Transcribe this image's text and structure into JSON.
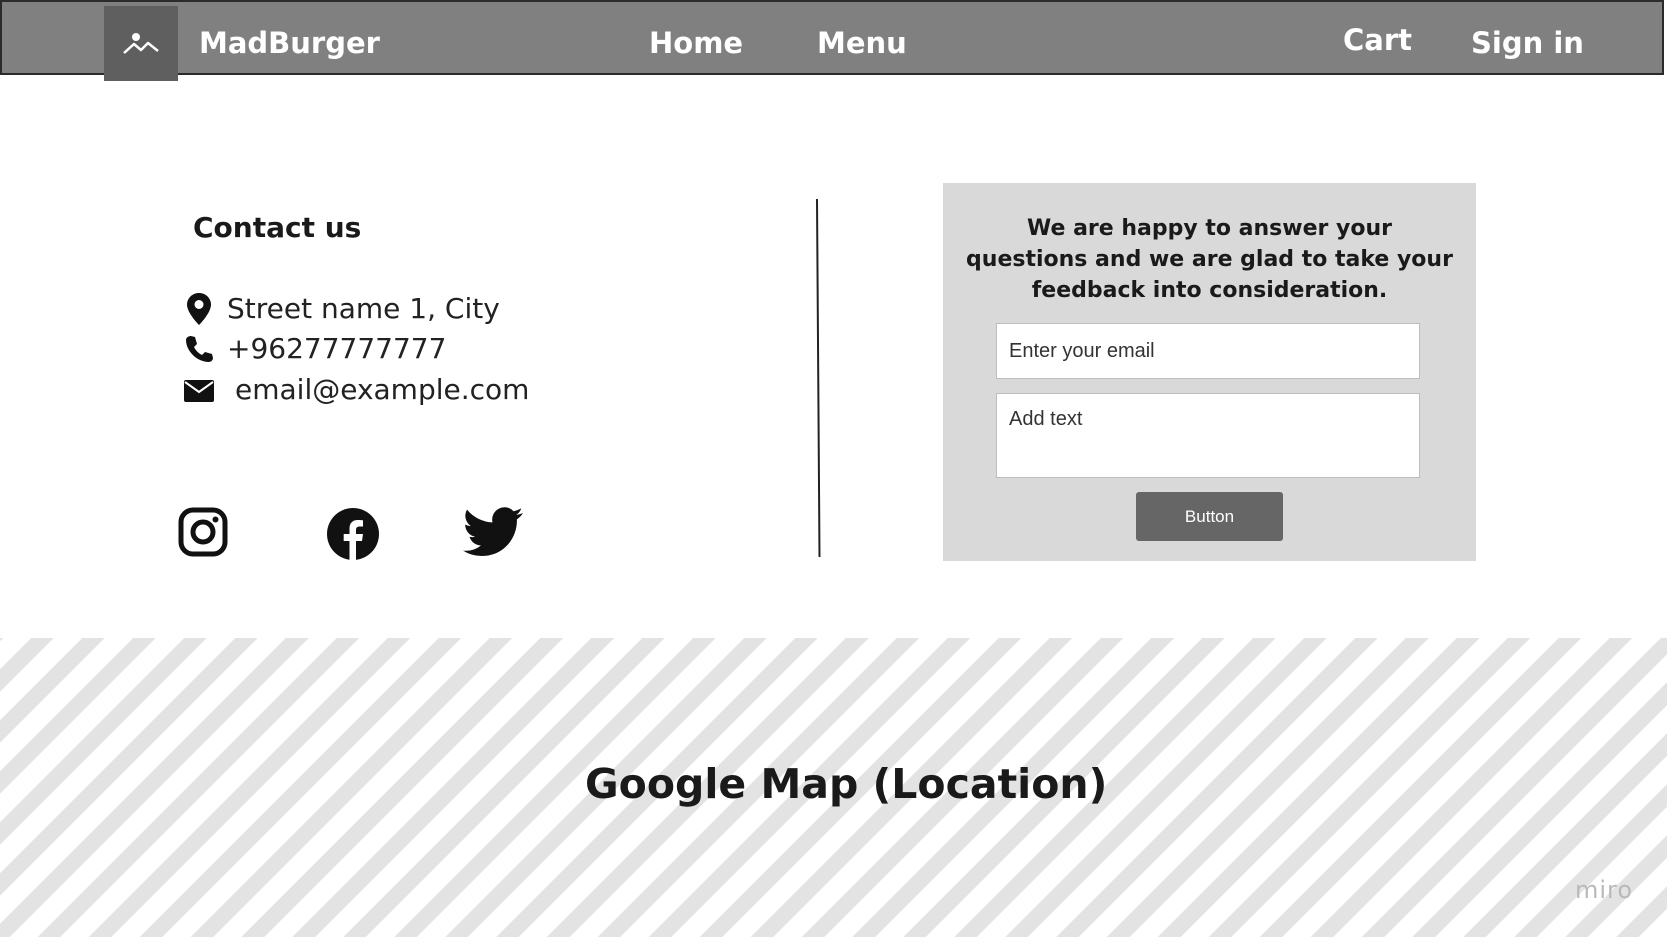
{
  "navbar": {
    "brand": "MadBurger",
    "links": {
      "home": "Home",
      "menu": "Menu",
      "cart": "Cart",
      "sign_in": "Sign in"
    }
  },
  "contact": {
    "title": "Contact us",
    "address": "Street name 1, City",
    "phone": "+96277777777",
    "email": "email@example.com"
  },
  "form": {
    "message": "We are happy to answer your questions and we are glad to take your feedback into consideration.",
    "email_placeholder": "Enter your email",
    "text_placeholder": "Add text",
    "button_label": "Button"
  },
  "map": {
    "label": "Google Map (Location)",
    "watermark": "miro"
  },
  "colors": {
    "navbar_bg": "#808080",
    "logo_bg": "#5f5f5f",
    "panel_bg": "#d9d9d9",
    "button_bg": "#666666"
  }
}
